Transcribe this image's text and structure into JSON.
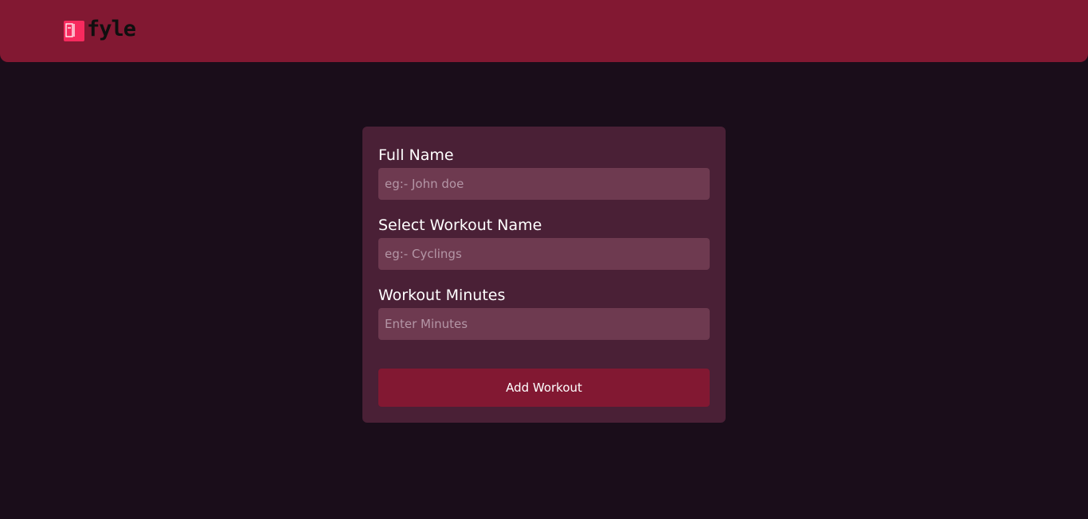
{
  "header": {
    "brand_name": "fyle",
    "brand_color": "#f72a5e",
    "background_color": "#821832"
  },
  "form": {
    "full_name": {
      "label": "Full Name",
      "placeholder": "eg:- John doe",
      "value": ""
    },
    "workout_name": {
      "label": "Select Workout Name",
      "placeholder": "eg:- Cyclings",
      "value": ""
    },
    "workout_minutes": {
      "label": "Workout Minutes",
      "placeholder": "Enter Minutes",
      "value": ""
    },
    "submit_label": "Add Workout"
  }
}
